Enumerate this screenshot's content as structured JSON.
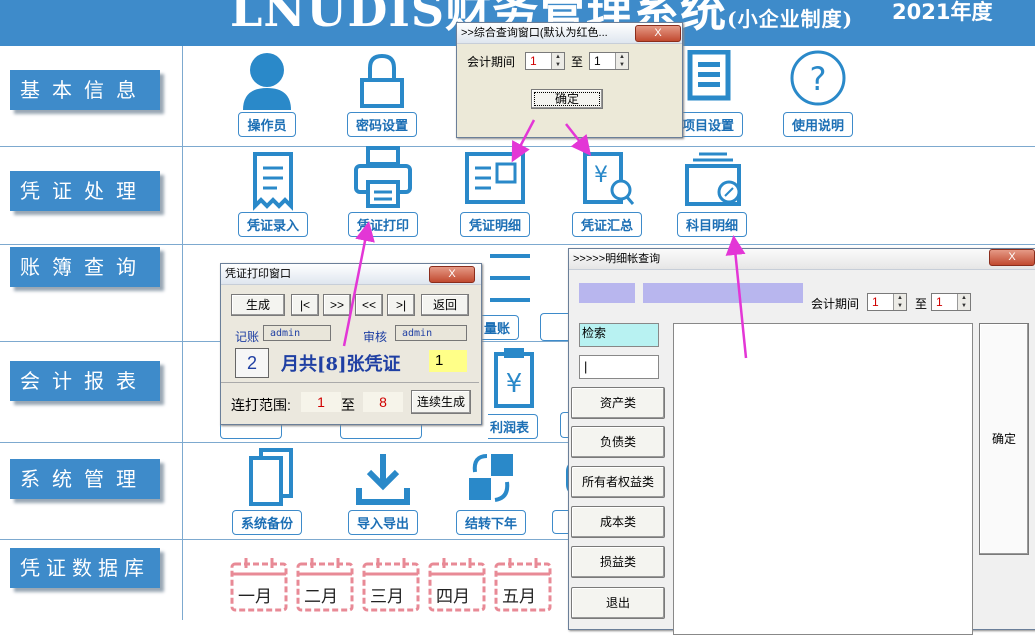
{
  "header": {
    "title": "LNUDIS财务管理系统",
    "subtitle": "(小企业制度)",
    "year_value": "2021",
    "year_suffix": "年度"
  },
  "sidebar": [
    {
      "label": "基本信息"
    },
    {
      "label": "凭证处理"
    },
    {
      "label": "账簿查询"
    },
    {
      "label": "会计报表"
    },
    {
      "label": "系统管理"
    },
    {
      "label": "凭证数据库"
    }
  ],
  "modules": {
    "basic": [
      "操作员",
      "密码设置",
      "项目设置",
      "使用说明"
    ],
    "voucher": [
      "凭证录入",
      "凭证打印",
      "凭证明细",
      "凭证汇总",
      "科目明细"
    ],
    "ledger_partial": "量账",
    "report_partial": "利润表",
    "system": [
      "系统备份",
      "导入导出",
      "结转下年"
    ],
    "months": [
      "一月",
      "二月",
      "三月",
      "四月",
      "五月"
    ]
  },
  "query_window": {
    "title": ">>综合查询窗口(默认为红色...",
    "close": "X",
    "period_label": "会计期间",
    "from_value": "1",
    "to_label": "至",
    "to_value": "1",
    "ok": "确定"
  },
  "print_window": {
    "title": "凭证打印窗口",
    "close": "X",
    "buttons": [
      "生成",
      "|<",
      ">>",
      "<<",
      ">|",
      "返回"
    ],
    "bookkeeper_label": "记账",
    "bookkeeper_value": "admin",
    "auditor_label": "审核",
    "auditor_value": "admin",
    "month_value": "2",
    "count_text": "月共[8]张凭证",
    "current_value": "1",
    "range_label": "连打范围:",
    "range_from": "1",
    "range_to_label": "至",
    "range_to": "8",
    "continuous_button": "连续生成"
  },
  "detail_window": {
    "title": ">>>>>明细帐查询",
    "close": "X",
    "period_label": "会计期间",
    "from_value": "1",
    "to_label": "至",
    "to_value": "1",
    "search_label": "检索",
    "search_value": "|",
    "categories": [
      "资产类",
      "负债类",
      "所有者权益类",
      "成本类",
      "损益类",
      "退出"
    ],
    "ok": "确定"
  },
  "colors": {
    "header_blue": "#3e8bca",
    "arrow_magenta": "#e336d6",
    "calendar_pink": "#e88a96"
  }
}
